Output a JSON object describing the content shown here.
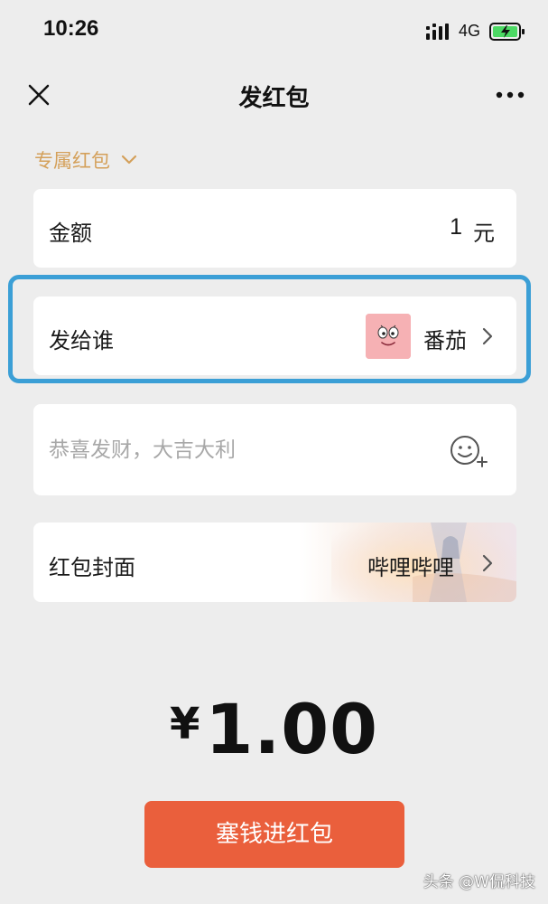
{
  "status_bar": {
    "time": "10:26",
    "network": "4G",
    "battery_icon": "battery-charging-icon",
    "signal_icon": "signal-bars-icon"
  },
  "nav": {
    "title": "发红包",
    "close_icon": "close-icon",
    "more_icon": "more-icon"
  },
  "type_selector": {
    "label": "专属红包",
    "icon": "chevron-down-icon",
    "color": "#d4a05a"
  },
  "amount": {
    "label": "金额",
    "value": "1",
    "unit": "元"
  },
  "recipient": {
    "label": "发给谁",
    "name": "番茄",
    "avatar_icon": "avatar",
    "avatar_color": "#f6b1b4",
    "highlight_color": "#3b9fd6"
  },
  "message": {
    "placeholder": "恭喜发财，大吉大利",
    "value": "",
    "emoji_icon": "emoji-add-icon"
  },
  "cover": {
    "label": "红包封面",
    "value": "哔哩哔哩"
  },
  "total": {
    "currency": "¥",
    "value": "1.00"
  },
  "submit": {
    "label": "塞钱进红包",
    "color": "#ea5f3c"
  },
  "watermark": "头条 @W侃科技"
}
